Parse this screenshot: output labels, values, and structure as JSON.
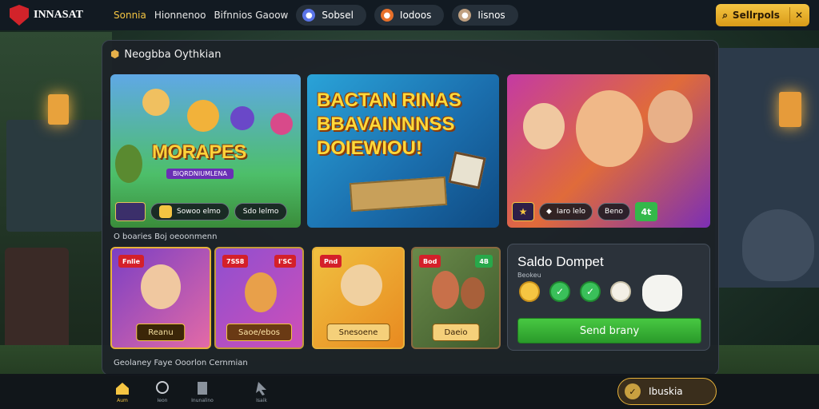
{
  "header": {
    "logo_text": "INNASAT",
    "nav": [
      "Sonnia",
      "Hionnenoo",
      "Bifnnios Gaoow"
    ],
    "pills": [
      {
        "label": "Sobsel",
        "icon": "chat-bubble-icon",
        "color": "#5a74e8"
      },
      {
        "label": "Iodoos",
        "icon": "fire-icon",
        "color": "#e8702a"
      },
      {
        "label": "Iisnos",
        "icon": "pirate-icon",
        "color": "#c0a080"
      }
    ],
    "login": {
      "label": "Sellrpols",
      "icon": "search-icon",
      "close_icon": "close-icon"
    }
  },
  "main": {
    "section1_title": "Neogbba Oythkian",
    "section2_title": "O boaries Boj oeoonmenn",
    "section3_title": "Geolaney Faye  Ooorlon Cernmian",
    "banners": [
      {
        "title": "MORAPES",
        "subtitle": "BIQRDNIUMLENA",
        "chip1": "Sowoo  elmo",
        "chip2": "Sdo lelmo"
      },
      {
        "title_lines": [
          "BACTAN RINAS",
          "BBAVAINNNSS",
          "DOIEWIOU!"
        ]
      },
      {
        "chip": "Iaro lelo",
        "chip2": "Beno",
        "green_badge": "4t"
      }
    ],
    "cards": [
      {
        "tag": "Fnlie",
        "button": "Reanu"
      },
      {
        "tag": "7SS8",
        "tag_right": "I'SC",
        "button": "Saoe/ebos"
      },
      {
        "tag": "Pnd",
        "button": "Snesoene"
      },
      {
        "tag": "Bod",
        "tag_right": "4B",
        "button": "Daeio"
      }
    ],
    "wallet": {
      "title": "Saldo Dompet",
      "subtitle": "Beokeu",
      "button": "Send brany"
    }
  },
  "bottom_nav": {
    "items": [
      {
        "label": "Aum",
        "icon": "home-icon"
      },
      {
        "label": "Ieon",
        "icon": "chat-icon"
      },
      {
        "label": "Inunalino",
        "icon": "document-icon"
      },
      {
        "label": "Isaik",
        "icon": "pointer-icon"
      }
    ],
    "right_button": "Ibuskia"
  }
}
